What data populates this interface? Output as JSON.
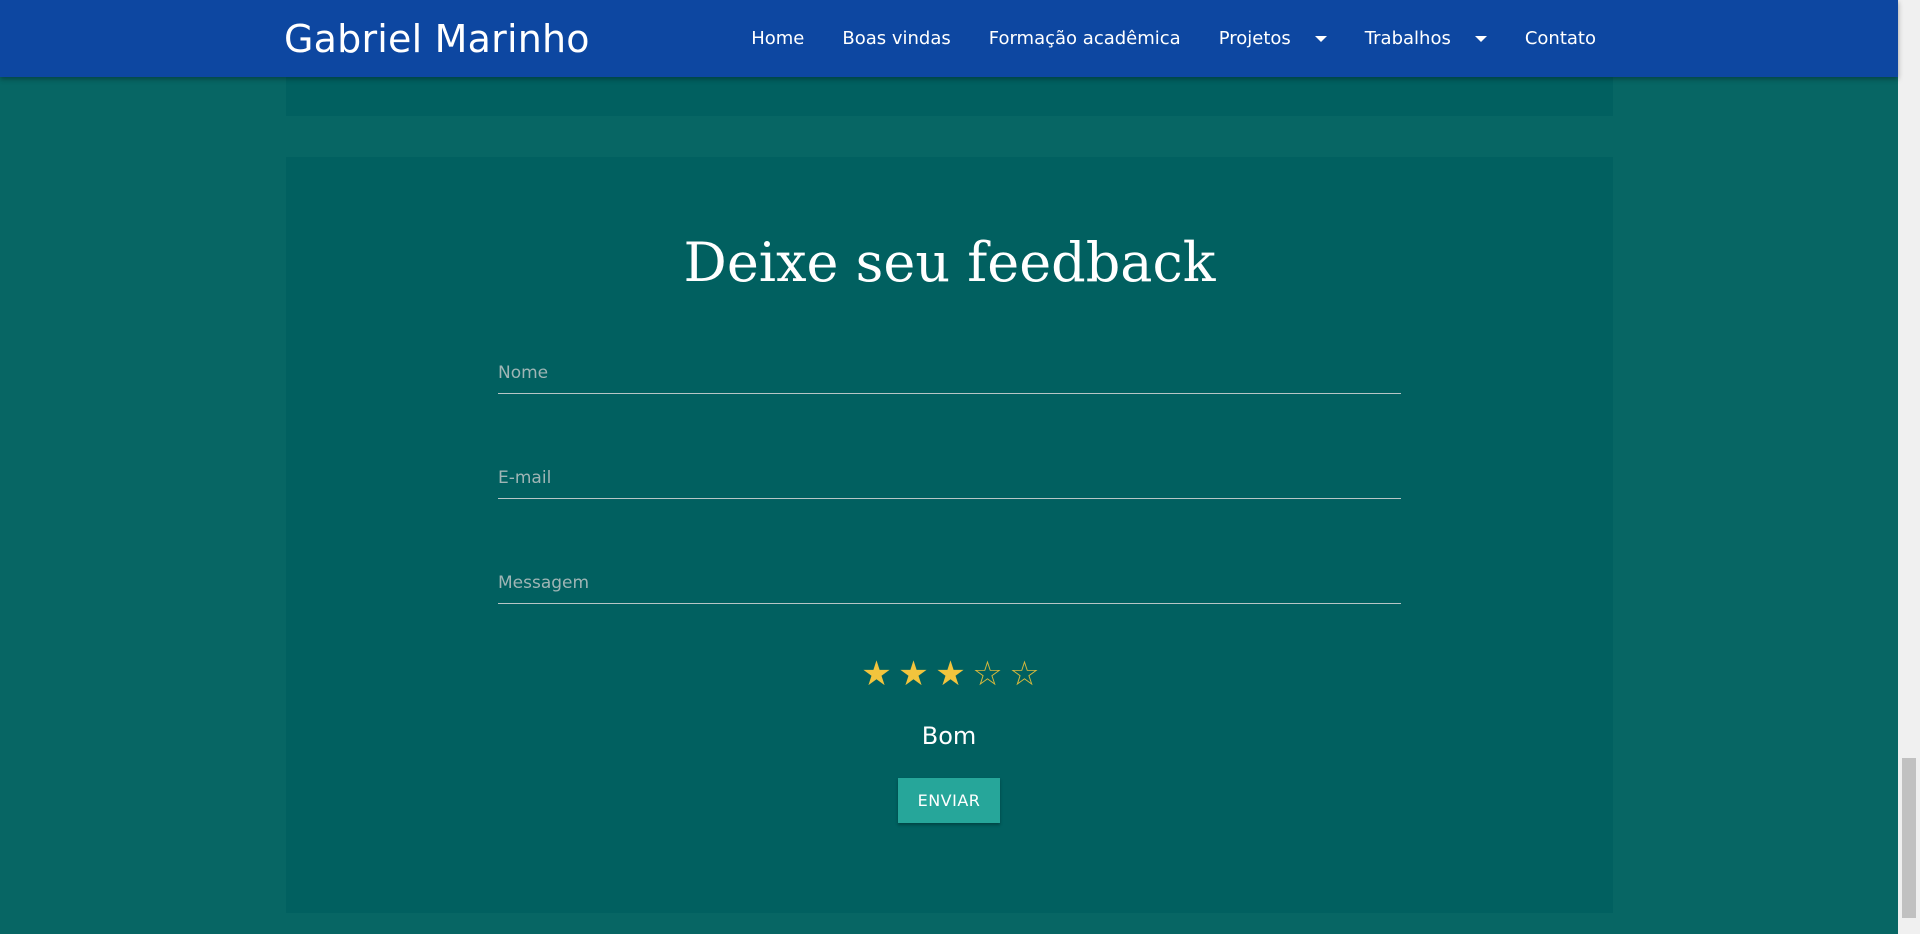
{
  "navbar": {
    "brand": "Gabriel Marinho",
    "items": [
      {
        "label": "Home",
        "dropdown": false
      },
      {
        "label": "Boas vindas",
        "dropdown": false
      },
      {
        "label": "Formação acadêmica",
        "dropdown": false
      },
      {
        "label": "Projetos",
        "dropdown": true
      },
      {
        "label": "Trabalhos",
        "dropdown": true
      },
      {
        "label": "Contato",
        "dropdown": false
      }
    ]
  },
  "feedback": {
    "title": "Deixe seu feedback",
    "fields": {
      "name_placeholder": "Nome",
      "email_placeholder": "E-mail",
      "message_placeholder": "Messagem"
    },
    "rating": {
      "value": 3,
      "max": 5,
      "label": "Bom",
      "star_filled_icon": "star-filled-icon",
      "star_empty_icon": "star-outline-icon",
      "star_color": "#f2c43d"
    },
    "submit_label": "ENVIAR"
  },
  "colors": {
    "navbar": "#0d47a1",
    "page_background": "#076664",
    "card_background": "#016060",
    "button": "#26a69a"
  }
}
